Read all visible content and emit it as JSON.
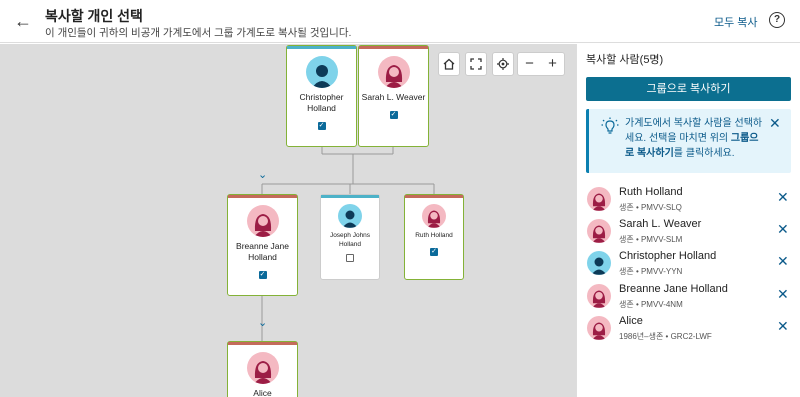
{
  "header": {
    "title": "복사할 개인 선택",
    "subtitle": "이 개인들이 귀하의 비공개 가계도에서 그룹 가계도로 복사될 것입니다.",
    "copy_all": "모두 복사"
  },
  "tree": {
    "people": {
      "christopher": {
        "name": "Christopher Holland",
        "gender": "male",
        "selected": true
      },
      "sarah": {
        "name": "Sarah L. Weaver",
        "gender": "female",
        "selected": true
      },
      "breanne": {
        "name": "Breanne Jane Holland",
        "gender": "female",
        "selected": true
      },
      "joseph": {
        "name": "Joseph Johns Holland",
        "gender": "male",
        "selected": false
      },
      "ruth": {
        "name": "Ruth Holland",
        "gender": "female",
        "selected": true
      },
      "alice": {
        "name": "Alice",
        "gender": "female",
        "selected": true
      }
    }
  },
  "panel": {
    "title": "복사할 사람(5명)",
    "copy_group_button": "그룹으로 복사하기",
    "tip_part1": "가계도에서 복사할 사람을 선택하세요. 선택을 마치면 위의 ",
    "tip_bold": "그룹으로 복사하기",
    "tip_part2": "를 클릭하세요.",
    "people": [
      {
        "name": "Ruth Holland",
        "meta": "생존 • PMVV-SLQ",
        "gender": "female"
      },
      {
        "name": "Sarah L. Weaver",
        "meta": "생존 • PMVV-SLM",
        "gender": "female"
      },
      {
        "name": "Christopher Holland",
        "meta": "생존 • PMVV-YYN",
        "gender": "male"
      },
      {
        "name": "Breanne Jane Holland",
        "meta": "생존 • PMVV-4NM",
        "gender": "female"
      },
      {
        "name": "Alice",
        "meta": "1986년–생존 • GRC2-LWF",
        "gender": "female"
      }
    ]
  },
  "colors": {
    "accent": "#0c6f90",
    "selected_border": "#84b237",
    "male": "#7fd3ea",
    "female": "#f4b9c2"
  },
  "icons": [
    "back-arrow-icon",
    "help-icon",
    "home-icon",
    "fullscreen-icon",
    "locate-icon",
    "zoom-out-icon",
    "zoom-in-icon",
    "lightbulb-icon",
    "close-icon",
    "chevron-down-icon",
    "checkbox-icon"
  ]
}
